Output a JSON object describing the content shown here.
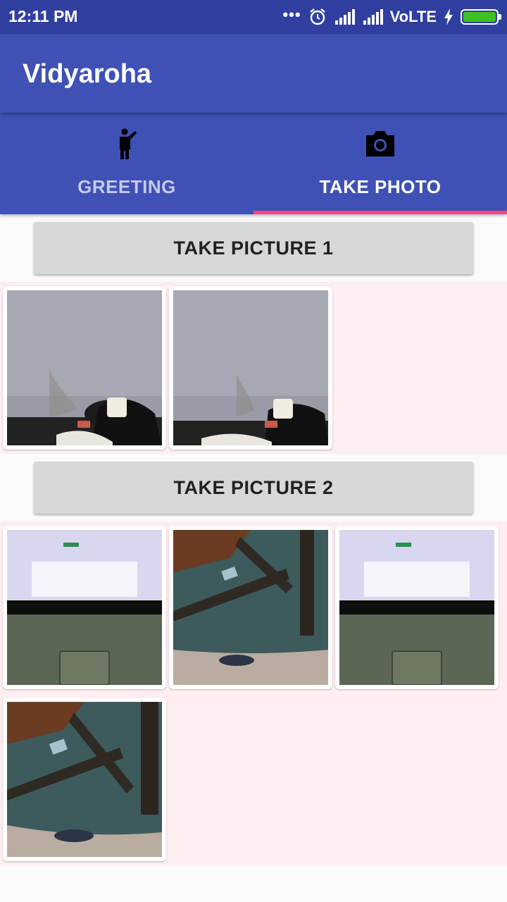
{
  "status_bar": {
    "time": "12:11 PM",
    "dots": "•••",
    "network": "VoLTE",
    "icons": [
      "alarm-icon",
      "signal-icon",
      "signal-icon",
      "charging-icon",
      "battery-icon"
    ],
    "battery_color": "#3dc21b"
  },
  "app_bar": {
    "title": "Vidyaroha"
  },
  "tabs": [
    {
      "label": "GREETING",
      "icon": "person-waving-icon",
      "selected": false
    },
    {
      "label": "TAKE PHOTO",
      "icon": "camera-icon",
      "selected": true
    }
  ],
  "colors": {
    "primary": "#3f51b5",
    "primary_dark": "#303f9f",
    "accent": "#ff4081",
    "grid_bg": "#ffeef0"
  },
  "sections": [
    {
      "button_label": "TAKE PICTURE 1",
      "photos": [
        {
          "subject": "wall-with-cup"
        },
        {
          "subject": "wall-with-cup"
        }
      ]
    },
    {
      "button_label": "TAKE PICTURE 2",
      "photos": [
        {
          "subject": "laptop-screen"
        },
        {
          "subject": "table-floor"
        },
        {
          "subject": "laptop-screen"
        },
        {
          "subject": "table-floor"
        }
      ]
    }
  ]
}
